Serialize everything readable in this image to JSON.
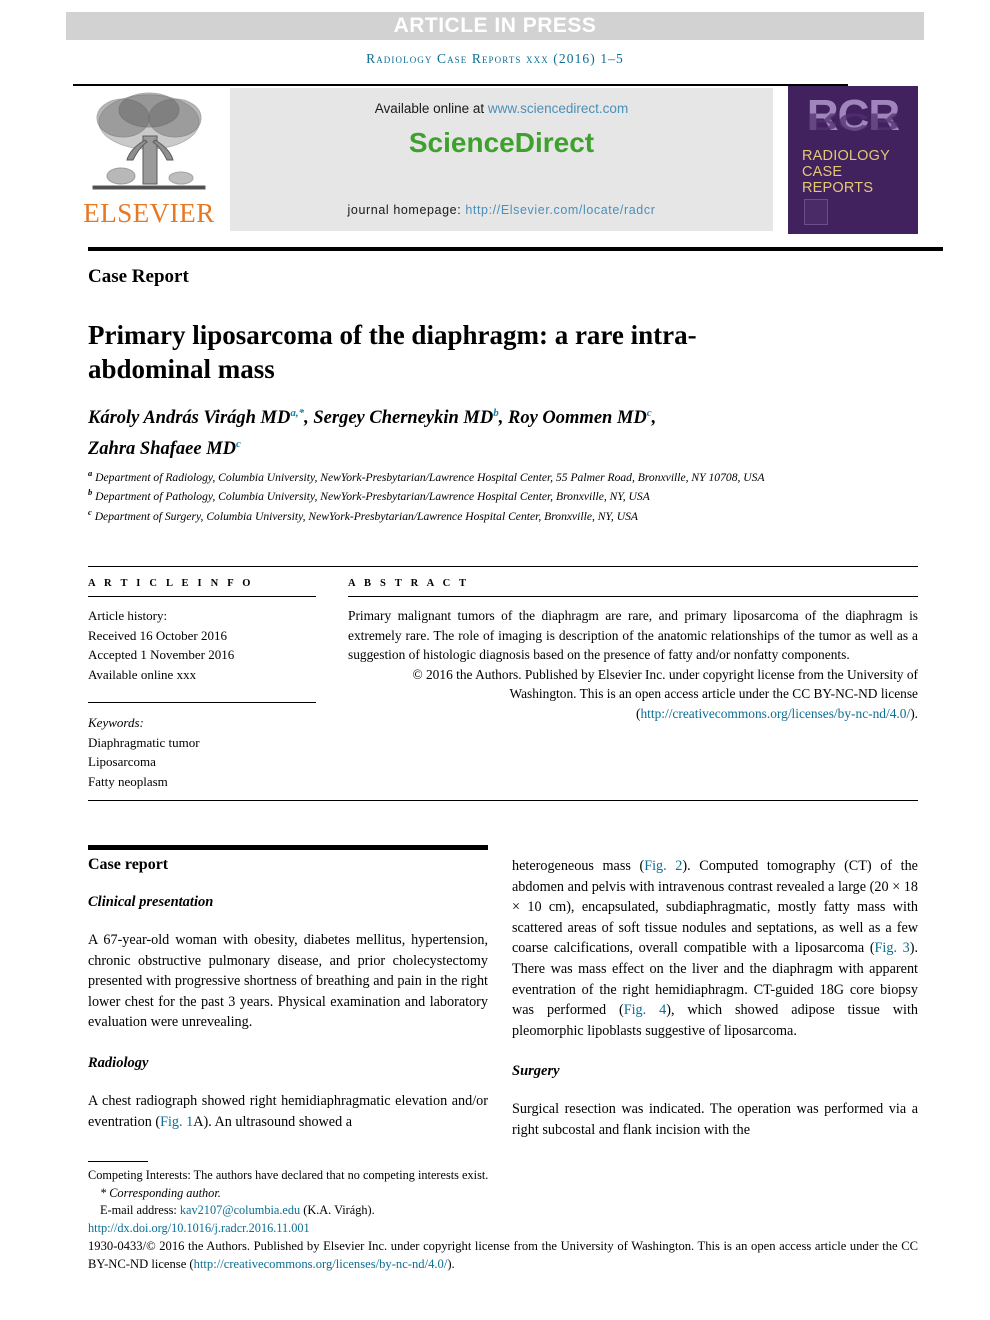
{
  "banner": {
    "label": "ARTICLE IN PRESS"
  },
  "running_head": "Radiology Case Reports xxx (2016) 1–5",
  "masthead": {
    "elsevier_wordmark": "ELSEVIER",
    "available_prefix": "Available online at ",
    "available_url": "www.sciencedirect.com",
    "sciencedirect_part1": "Science",
    "sciencedirect_part2": "Direct",
    "homepage_label": "journal homepage: ",
    "homepage_url": "http://Elsevier.com/locate/radcr",
    "rcr_initials": "RCR",
    "rcr_line1": "RADIOLOGY",
    "rcr_line2": "CASE",
    "rcr_line3": "REPORTS"
  },
  "article": {
    "kicker": "Case Report",
    "title": "Primary liposarcoma of the diaphragm: a rare intra-abdominal mass",
    "authors": [
      {
        "name": "Károly András Virágh MD",
        "marks": "a,*"
      },
      {
        "name": "Sergey Cherneykin MD",
        "marks": "b"
      },
      {
        "name": "Roy Oommen MD",
        "marks": "c"
      },
      {
        "name": "Zahra Shafaee MD",
        "marks": "c"
      }
    ],
    "affiliations": [
      {
        "mark": "a",
        "text": "Department of Radiology, Columbia University, NewYork-Presbytarian/Lawrence Hospital Center, 55 Palmer Road, Bronxville, NY 10708, USA"
      },
      {
        "mark": "b",
        "text": "Department of Pathology, Columbia University, NewYork-Presbytarian/Lawrence Hospital Center, Bronxville, NY, USA"
      },
      {
        "mark": "c",
        "text": "Department of Surgery, Columbia University, NewYork-Presbytarian/Lawrence Hospital Center, Bronxville, NY, USA"
      }
    ]
  },
  "article_info": {
    "label": "A R T I C L E   I N F O",
    "history_label": "Article history:",
    "received": "Received 16 October 2016",
    "accepted": "Accepted 1 November 2016",
    "available": "Available online xxx",
    "keywords_label": "Keywords:",
    "keywords": [
      "Diaphragmatic tumor",
      "Liposarcoma",
      "Fatty neoplasm"
    ]
  },
  "abstract": {
    "label": "A B S T R A C T",
    "text": "Primary malignant tumors of the diaphragm are rare, and primary liposarcoma of the diaphragm is extremely rare. The role of imaging is description of the anatomic relationships of the tumor as well as a suggestion of histologic diagnosis based on the presence of fatty and/or nonfatty components.",
    "copyright_text": "© 2016 the Authors. Published by Elsevier Inc. under copyright license from the University of Washington. This is an open access article under the CC BY-NC-ND license (",
    "copyright_link": "http://creativecommons.org/licenses/by-nc-nd/4.0/",
    "copyright_tail": ")."
  },
  "body": {
    "left": {
      "section_heading": "Case report",
      "sub1": "Clinical presentation",
      "para1": "A 67-year-old woman with obesity, diabetes mellitus, hypertension, chronic obstructive pulmonary disease, and prior cholecystectomy presented with progressive shortness of breathing and pain in the right lower chest for the past 3 years. Physical examination and laboratory evaluation were unrevealing.",
      "sub2": "Radiology",
      "para2_a": "A chest radiograph showed right hemidiaphragmatic elevation and/or eventration (",
      "para2_link": "Fig. 1",
      "para2_b": "A). An ultrasound showed a"
    },
    "right": {
      "para1_a": "heterogeneous mass (",
      "para1_link1": "Fig. 2",
      "para1_b": "). Computed tomography (CT) of the abdomen and pelvis with intravenous contrast revealed a large (20 × 18 × 10 cm), encapsulated, subdiaphragmatic, mostly fatty mass with scattered areas of soft tissue nodules and septations, as well as a few coarse calcifications, overall compatible with a liposarcoma (",
      "para1_link2": "Fig. 3",
      "para1_c": "). There was mass effect on the liver and the diaphragm with apparent eventration of the right hemidiaphragm. CT-guided 18G core biopsy was performed (",
      "para1_link3": "Fig. 4",
      "para1_d": "), which showed adipose tissue with pleomorphic lipoblasts suggestive of liposarcoma.",
      "sub1": "Surgery",
      "para2": "Surgical resection was indicated. The operation was performed via a right subcostal and flank incision with the"
    }
  },
  "footnotes": {
    "competing": "Competing Interests: The authors have declared that no competing interests exist.",
    "corresponding": "* Corresponding author.",
    "email_label": "E-mail address: ",
    "email": "kav2107@columbia.edu",
    "email_suffix": " (K.A. Virágh).",
    "doi": "http://dx.doi.org/10.1016/j.radcr.2016.11.001",
    "issn_copy": "1930-0433/© 2016 the Authors. Published by Elsevier Inc. under copyright license from the University of Washington. This is an open access article under the CC BY-NC-ND license (",
    "issn_link": "http://creativecommons.org/licenses/by-nc-nd/4.0/",
    "issn_tail": ")."
  },
  "colors": {
    "link": "#0a6e94",
    "banner_bg": "#d2d2d2",
    "sciencedirect_green": "#3ea12e",
    "elsevier_orange": "#e87722",
    "rcr_purple": "#41215e",
    "rcr_gold": "#e3c878"
  }
}
